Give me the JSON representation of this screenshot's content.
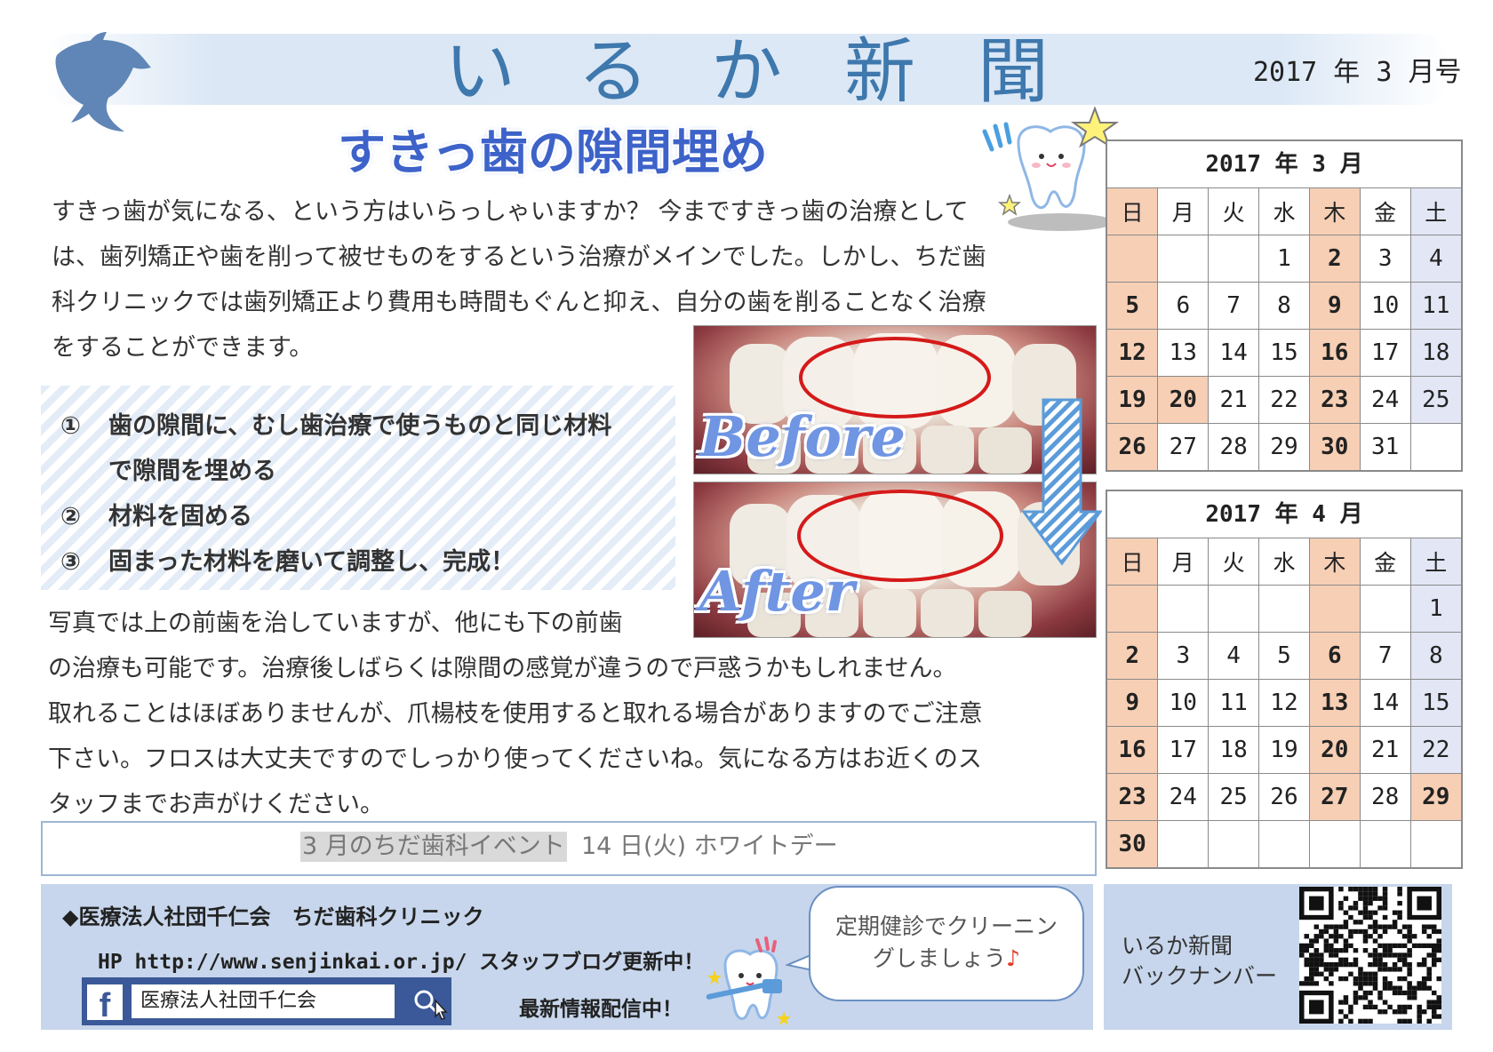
{
  "header": {
    "title": "いるか新聞",
    "issue": "2017 年 3 月号"
  },
  "article": {
    "title": "すきっ歯の隙間埋め",
    "intro_lines": [
      "すきっ歯が気になる、という方はいらっしゃいますか？ 今まですきっ歯の治療として",
      "は、歯列矯正や歯を削って被せものをするという治療がメインでした。しかし、ちだ歯",
      "科クリニックでは歯列矯正より費用も時間もぐんと抑え、自分の歯を削ることなく治療",
      "をすることができます。"
    ],
    "steps": [
      {
        "num": "①",
        "line1": "歯の隙間に、むし歯治療で使うものと同じ材料",
        "line2": "で隙間を埋める"
      },
      {
        "num": "②",
        "line1": "材料を固める",
        "line2": ""
      },
      {
        "num": "③",
        "line1": "固まった材料を磨いて調整し、完成！",
        "line2": ""
      }
    ],
    "after_lines": [
      "写真では上の前歯を治していますが、他にも下の前歯",
      "の治療も可能です。治療後しばらくは隙間の感覚が違うので戸惑うかもしれません。",
      "取れることはほぼありませんが、爪楊枝を使用すると取れる場合がありますのでご注意",
      "下さい。フロスは大丈夫ですのでしっかり使ってくださいね。気になる方はお近くのス",
      "タッフまでお声がけください。"
    ],
    "photo_before_label": "Before",
    "photo_after_label": "After"
  },
  "calendars": [
    {
      "title": "2017 年 3  月",
      "weekdays": [
        "日",
        "月",
        "火",
        "水",
        "木",
        "金",
        "土"
      ],
      "weeks": [
        [
          {
            "d": "",
            "t": "h"
          },
          {
            "d": "",
            "t": ""
          },
          {
            "d": "",
            "t": ""
          },
          {
            "d": "1",
            "t": ""
          },
          {
            "d": "2",
            "t": "h"
          },
          {
            "d": "3",
            "t": ""
          },
          {
            "d": "4",
            "t": "s"
          }
        ],
        [
          {
            "d": "5",
            "t": "h"
          },
          {
            "d": "6",
            "t": ""
          },
          {
            "d": "7",
            "t": ""
          },
          {
            "d": "8",
            "t": ""
          },
          {
            "d": "9",
            "t": "h"
          },
          {
            "d": "10",
            "t": ""
          },
          {
            "d": "11",
            "t": "s"
          }
        ],
        [
          {
            "d": "12",
            "t": "h"
          },
          {
            "d": "13",
            "t": ""
          },
          {
            "d": "14",
            "t": ""
          },
          {
            "d": "15",
            "t": ""
          },
          {
            "d": "16",
            "t": "h"
          },
          {
            "d": "17",
            "t": ""
          },
          {
            "d": "18",
            "t": "s"
          }
        ],
        [
          {
            "d": "19",
            "t": "h"
          },
          {
            "d": "20",
            "t": "h"
          },
          {
            "d": "21",
            "t": ""
          },
          {
            "d": "22",
            "t": ""
          },
          {
            "d": "23",
            "t": "h"
          },
          {
            "d": "24",
            "t": ""
          },
          {
            "d": "25",
            "t": "s"
          }
        ],
        [
          {
            "d": "26",
            "t": "h"
          },
          {
            "d": "27",
            "t": ""
          },
          {
            "d": "28",
            "t": ""
          },
          {
            "d": "29",
            "t": ""
          },
          {
            "d": "30",
            "t": "h"
          },
          {
            "d": "31",
            "t": ""
          },
          {
            "d": "",
            "t": ""
          }
        ]
      ]
    },
    {
      "title": "2017 年 4  月",
      "weekdays": [
        "日",
        "月",
        "火",
        "水",
        "木",
        "金",
        "土"
      ],
      "weeks": [
        [
          {
            "d": "",
            "t": "h"
          },
          {
            "d": "",
            "t": ""
          },
          {
            "d": "",
            "t": ""
          },
          {
            "d": "",
            "t": ""
          },
          {
            "d": "",
            "t": "h"
          },
          {
            "d": "",
            "t": ""
          },
          {
            "d": "1",
            "t": "s"
          }
        ],
        [
          {
            "d": "2",
            "t": "h"
          },
          {
            "d": "3",
            "t": ""
          },
          {
            "d": "4",
            "t": ""
          },
          {
            "d": "5",
            "t": ""
          },
          {
            "d": "6",
            "t": "h"
          },
          {
            "d": "7",
            "t": ""
          },
          {
            "d": "8",
            "t": "s"
          }
        ],
        [
          {
            "d": "9",
            "t": "h"
          },
          {
            "d": "10",
            "t": ""
          },
          {
            "d": "11",
            "t": ""
          },
          {
            "d": "12",
            "t": ""
          },
          {
            "d": "13",
            "t": "h"
          },
          {
            "d": "14",
            "t": ""
          },
          {
            "d": "15",
            "t": "s"
          }
        ],
        [
          {
            "d": "16",
            "t": "h"
          },
          {
            "d": "17",
            "t": ""
          },
          {
            "d": "18",
            "t": ""
          },
          {
            "d": "19",
            "t": ""
          },
          {
            "d": "20",
            "t": "h"
          },
          {
            "d": "21",
            "t": ""
          },
          {
            "d": "22",
            "t": "s"
          }
        ],
        [
          {
            "d": "23",
            "t": "h"
          },
          {
            "d": "24",
            "t": ""
          },
          {
            "d": "25",
            "t": ""
          },
          {
            "d": "26",
            "t": ""
          },
          {
            "d": "27",
            "t": "h"
          },
          {
            "d": "28",
            "t": ""
          },
          {
            "d": "29",
            "t": "h"
          }
        ],
        [
          {
            "d": "30",
            "t": "h"
          },
          {
            "d": "",
            "t": ""
          },
          {
            "d": "",
            "t": ""
          },
          {
            "d": "",
            "t": ""
          },
          {
            "d": "",
            "t": ""
          },
          {
            "d": "",
            "t": ""
          },
          {
            "d": "",
            "t": ""
          }
        ]
      ]
    }
  ],
  "event": {
    "label": "3 月のちだ歯科イベント",
    "detail": "14 日(火) ホワイトデー"
  },
  "footer": {
    "clinic": "◆医療法人社団千仁会　ちだ歯科クリニック",
    "hp_prefix": "HP http://www.senjinkai.or.jp/",
    "blog": "スタッフブログ更新中！",
    "facebook_search": "医療法人社団千仁会",
    "latest": "最新情報配信中！",
    "bubble_line1": "定期健診でクリーニン",
    "bubble_line2": "グしましょう",
    "bubble_note": "♪",
    "backnumber_line1": "いるか新聞",
    "backnumber_line2": "バックナンバー"
  },
  "colors": {
    "title_blue": "#3e78ad",
    "holiday_orange": "#f7cfb5",
    "saturday_lavender": "#e2e6f5",
    "footer_blue": "#c7d6ec",
    "facebook_blue": "#3b5998"
  },
  "icons": [
    "dolphin-icon",
    "tooth-mascot-icon",
    "down-arrow-icon",
    "facebook-icon",
    "search-icon",
    "tooth-brush-icon",
    "qr-code-icon"
  ]
}
